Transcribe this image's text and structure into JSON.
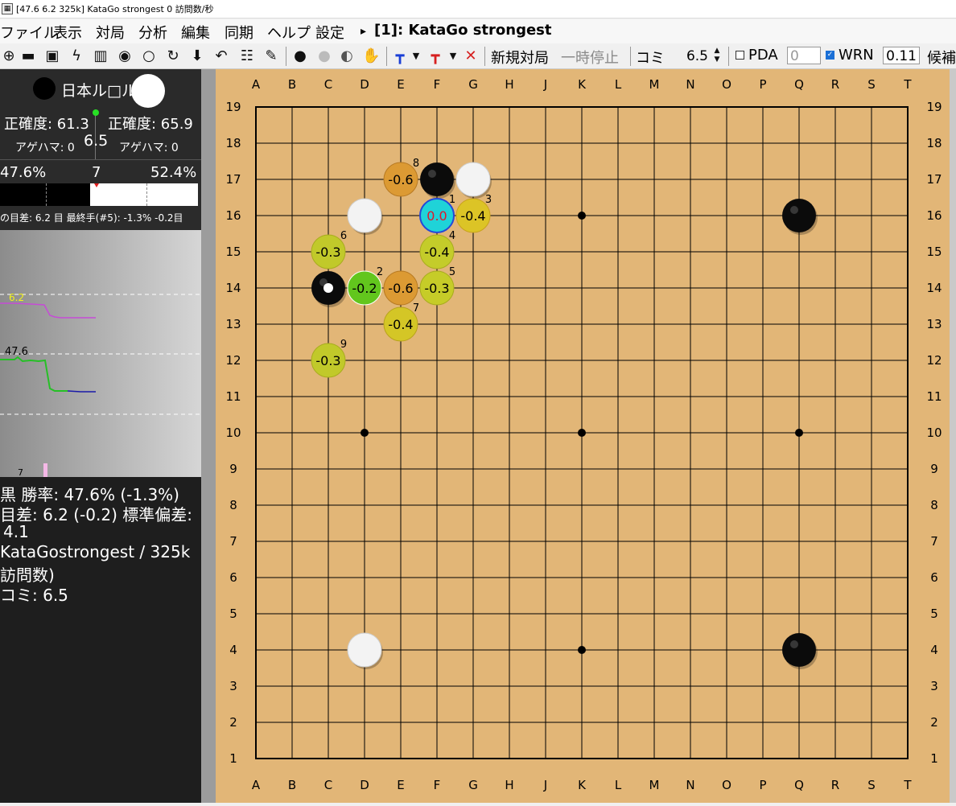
{
  "window": {
    "title": "[47.6 6.2 325k] KataGo strongest 0 訪問数/秒",
    "icon": "app-icon"
  },
  "menu": {
    "items": [
      "ファイル",
      "表示",
      "対局",
      "分析",
      "編集",
      "同期",
      "ヘルプ",
      "設定"
    ],
    "play_arrow": "▸",
    "engine_label": "[1]: KataGo strongest"
  },
  "toolbar": {
    "new_game": "新規対局",
    "pause": "一時停止",
    "komi_label": "コミ",
    "komi_value": "6.5",
    "pda_label": "PDA",
    "pda_value": "0",
    "wrn_label": "WRN",
    "wrn_value": "0.11",
    "candidates_label": "候補",
    "icons": [
      "new-game-icon",
      "open-file-icon",
      "save-icon",
      "flash-icon",
      "graph-icon",
      "analysis-icon",
      "circle-icon",
      "sync-icon",
      "down-arrow-icon",
      "undo-icon",
      "sliders-icon",
      "brush-icon",
      "black-stone-icon",
      "white-stone-icon",
      "mixed-stones-icon",
      "hand-icon",
      "blue-move-icon",
      "red-move-icon",
      "close-icon"
    ]
  },
  "info": {
    "rule_label": "日本ル□ル",
    "black_accuracy": "正確度: 61.3",
    "white_accuracy": "正確度: 65.9",
    "black_captures": "アゲハマ: 0",
    "white_captures": "アゲハマ: 0",
    "komi": "6.5"
  },
  "winbar": {
    "black_pct": "47.6%",
    "move_number": "7",
    "white_pct": "52.4%",
    "black_fraction": 0.476,
    "status": "の目差: 6.2 目 最終手(#5): -1.3% -0.2目"
  },
  "graph": {
    "score_label": "6.2",
    "winrate_label": "47.6",
    "move_label": "7"
  },
  "stats": {
    "line1": "黒 勝率: 47.6% (-1.3%)",
    "line2": "目差: 6.2 (-0.2) 標準偏差:",
    "line3": "4.1",
    "line4": "KataGostrongest / 325k",
    "line5": "訪問数)",
    "line6": "コミ: 6.5"
  },
  "board": {
    "columns": [
      "A",
      "B",
      "C",
      "D",
      "E",
      "F",
      "G",
      "H",
      "J",
      "K",
      "L",
      "M",
      "N",
      "O",
      "P",
      "Q",
      "R",
      "S",
      "T"
    ],
    "rows": [
      "19",
      "18",
      "17",
      "16",
      "15",
      "14",
      "13",
      "12",
      "11",
      "10",
      "9",
      "8",
      "7",
      "6",
      "5",
      "4",
      "3",
      "2",
      "1"
    ],
    "hoshi": [
      "D16",
      "K16",
      "Q16",
      "D10",
      "K10",
      "Q10",
      "D4",
      "K4",
      "Q4"
    ],
    "black_stones": [
      "F17",
      "Q16",
      "C14",
      "Q4"
    ],
    "white_stones": [
      "G17",
      "D16",
      "D4"
    ],
    "last_move": "C14",
    "candidates": [
      {
        "pos": "F16",
        "value": "0.0",
        "rank": "1",
        "color": "#1fd3d8",
        "text_color": "#e0182b",
        "border": "#2448d8"
      },
      {
        "pos": "D14",
        "value": "-0.2",
        "rank": "2",
        "color": "#62c61d",
        "text_color": "#000000",
        "border": "#ffffff"
      },
      {
        "pos": "G16",
        "value": "-0.4",
        "rank": "3",
        "color": "#dcc426",
        "text_color": "#000000",
        "border": "#c9a31c"
      },
      {
        "pos": "F15",
        "value": "-0.4",
        "rank": "4",
        "color": "#c4cc2a",
        "text_color": "#000000",
        "border": "#a8ac1e"
      },
      {
        "pos": "F14",
        "value": "-0.3",
        "rank": "5",
        "color": "#c6cc28",
        "text_color": "#000000",
        "border": "#a8ac1e"
      },
      {
        "pos": "C15",
        "value": "-0.3",
        "rank": "6",
        "color": "#c1c92a",
        "text_color": "#000000",
        "border": "#a8ac1e"
      },
      {
        "pos": "E13",
        "value": "-0.4",
        "rank": "7",
        "color": "#d4c626",
        "text_color": "#000000",
        "border": "#b9a31d"
      },
      {
        "pos": "E17",
        "value": "-0.6",
        "rank": "8",
        "color": "#dc9a33",
        "text_color": "#000000",
        "border": "#b87a22"
      },
      {
        "pos": "C12",
        "value": "-0.3",
        "rank": "9",
        "color": "#c1c92a",
        "text_color": "#000000",
        "border": "#a8ac1e"
      },
      {
        "pos": "E14",
        "value": "-0.6",
        "rank": "",
        "color": "#dc9a33",
        "text_color": "#000000",
        "border": "#b87a22"
      }
    ]
  }
}
